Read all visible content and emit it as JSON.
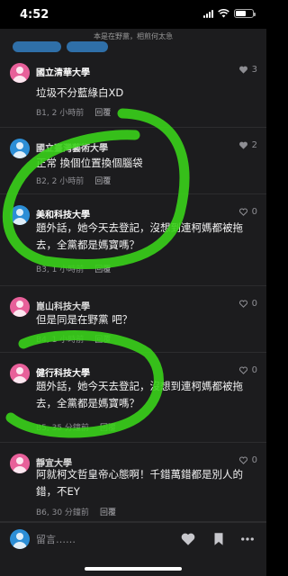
{
  "status": {
    "time": "4:52"
  },
  "top_hint": "本是在野黨，相煎何太急",
  "colors": {
    "pink": "#e8609a",
    "blue": "#2c8ed6",
    "green": "#3ad21a",
    "bg": "#1c1c1e"
  },
  "comments": [
    {
      "school": "國立清華大學",
      "text": "垃圾不分藍綠白XD",
      "floor": "B1, 2 小時前",
      "reply": "回覆",
      "likes": "3",
      "avatar": "pink",
      "liked": true
    },
    {
      "school": "國立臺灣藝術大學",
      "text": "正常 換個位置換個腦袋",
      "floor": "B2, 2 小時前",
      "reply": "回覆",
      "likes": "2",
      "avatar": "blue",
      "liked": true
    },
    {
      "school": "美和科技大學",
      "text": "題外話，她今天去登記，沒想到連柯媽都被拖去，全黨都是媽寶嗎？",
      "floor": "B3, 1 小時前",
      "reply": "回覆",
      "likes": "0",
      "avatar": "blue",
      "liked": false
    },
    {
      "school": "崑山科技大學",
      "text": "但是同是在野黨 吧？",
      "floor": "B4, 1 小時前",
      "reply": "回覆",
      "likes": "0",
      "avatar": "pink",
      "liked": false
    },
    {
      "school": "健行科技大學",
      "text": "題外話，她今天去登記，沒想到連柯媽都被拖去，全黨都是媽寶嗎？",
      "floor": "B5, 35 分鐘前",
      "reply": "回覆",
      "likes": "0",
      "avatar": "pink",
      "liked": false
    },
    {
      "school": "靜宜大學",
      "text": "阿就柯文哲皇帝心態啊！千錯萬錯都是別人的錯，不EY",
      "floor": "B6, 30 分鐘前",
      "reply": "回覆",
      "likes": "0",
      "avatar": "pink",
      "liked": false
    }
  ],
  "bottom": {
    "placeholder": "留言……"
  }
}
